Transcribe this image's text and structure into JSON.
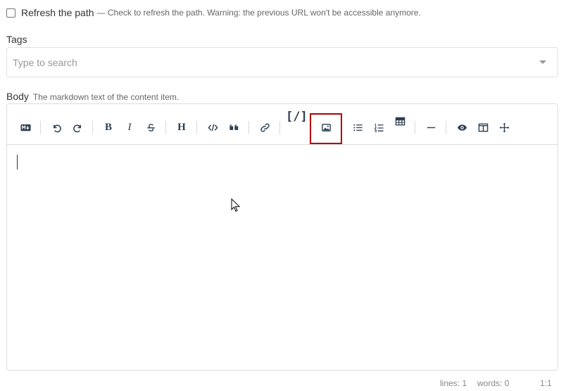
{
  "refresh": {
    "label": "Refresh the path",
    "hint": "— Check to refresh the path. Warning: the previous URL won't be accessible anymore.",
    "checked": false
  },
  "tags": {
    "label": "Tags",
    "placeholder": "Type to search"
  },
  "body": {
    "label": "Body",
    "hint": "The markdown text of the content item."
  },
  "toolbar": {
    "buttons": [
      {
        "icon": "markdown-icon"
      },
      {
        "icon": "undo-icon"
      },
      {
        "icon": "redo-icon"
      },
      {
        "icon": "bold-icon",
        "glyph": "B"
      },
      {
        "icon": "italic-icon",
        "glyph": "I"
      },
      {
        "icon": "strikethrough-icon"
      },
      {
        "icon": "heading-icon",
        "glyph": "H"
      },
      {
        "icon": "code-icon"
      },
      {
        "icon": "quote-icon"
      },
      {
        "icon": "link-icon"
      },
      {
        "icon": "code-block-icon",
        "glyph": "[/]"
      },
      {
        "icon": "image-icon",
        "highlighted": true
      },
      {
        "icon": "unordered-list-icon"
      },
      {
        "icon": "ordered-list-icon"
      },
      {
        "icon": "table-icon"
      },
      {
        "icon": "horizontal-rule-icon"
      },
      {
        "icon": "preview-icon"
      },
      {
        "icon": "side-by-side-icon"
      },
      {
        "icon": "fullscreen-icon"
      }
    ],
    "highlight_color": "#b00000"
  },
  "status": {
    "lines": "lines: 1",
    "words": "words: 0",
    "cursor": "1:1"
  }
}
